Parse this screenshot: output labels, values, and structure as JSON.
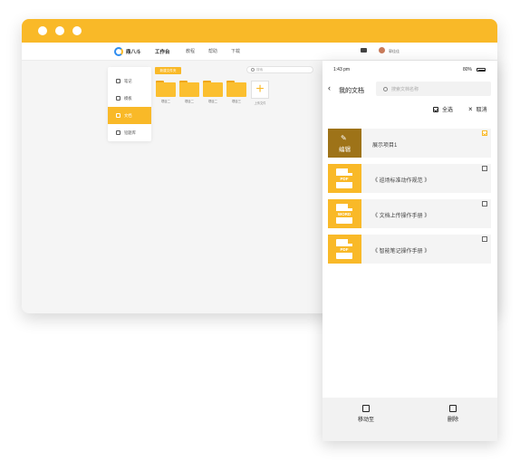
{
  "desktop": {
    "logo_text": "鼎八斗",
    "nav": [
      "工作台",
      "教程",
      "帮助",
      "下载"
    ],
    "user_name": "郭佳佳",
    "sidebar": [
      "笔记",
      "模板",
      "文档",
      "铅题库"
    ],
    "new_folder_label": "新建文件夹",
    "search_placeholder": "搜索",
    "folders": [
      "项目二",
      "项目二",
      "项目二",
      "项目三"
    ],
    "upload_label": "上传文件"
  },
  "phone": {
    "time": "1:43 pm",
    "battery": "80%",
    "title": "我的文档",
    "search_placeholder": "搜索文档名称",
    "select_all": "全选",
    "cancel": "取消",
    "edit_label": "编辑",
    "files": [
      {
        "name": "展示项目1",
        "tag": "",
        "checked": true
      },
      {
        "name": "《 巡场标准动作规范 》",
        "tag": "PDF",
        "checked": false
      },
      {
        "name": "《 文档上传操作手册 》",
        "tag": "WORD",
        "checked": false
      },
      {
        "name": "《 智能笔记操作手册 》",
        "tag": "PDF",
        "checked": false
      }
    ],
    "move_to": "移动至",
    "delete": "删除"
  },
  "colors": {
    "accent": "#f9b928",
    "edit_thumb": "#9e7318"
  }
}
